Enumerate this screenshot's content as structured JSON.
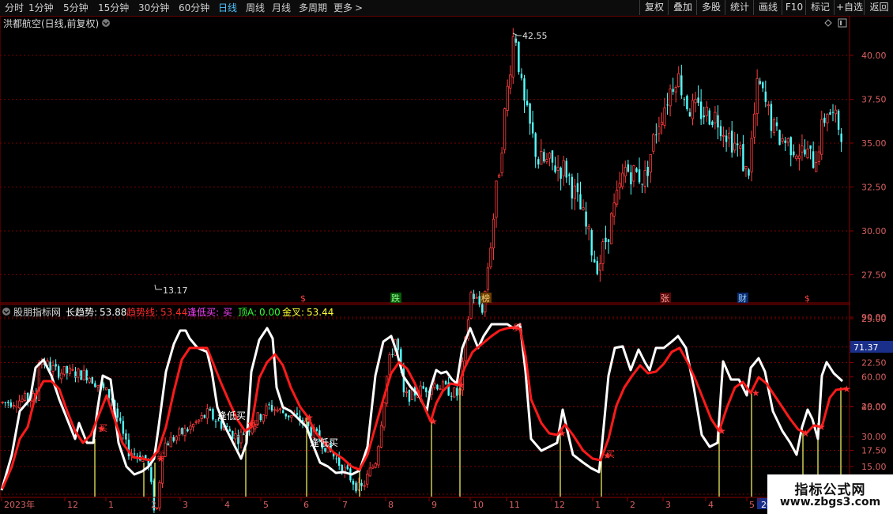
{
  "toolbar": {
    "periods": [
      "分时",
      "1分钟",
      "5分钟",
      "15分钟",
      "30分钟",
      "60分钟",
      "日线",
      "周线",
      "月线",
      "多周期",
      "更多"
    ],
    "active_period": "日线",
    "more_arrow": ">",
    "actions": [
      "复权",
      "叠加",
      "多股",
      "统计",
      "画线",
      "F10",
      "标记",
      "+自选",
      "返回"
    ]
  },
  "price_panel": {
    "title": "洪都航空(日线,前复权)",
    "high_label": "42.55",
    "low_label": "13.17",
    "axis_ticks": [
      "40.00",
      "37.50",
      "35.00",
      "32.50",
      "30.00",
      "27.50",
      "25.00",
      "22.50",
      "20.00",
      "17.50",
      "15.00"
    ],
    "events": [
      "$",
      "跌",
      "榜",
      "张",
      "财",
      "$"
    ],
    "colors": {
      "up": "#ff3c3c",
      "down": "#54ffff",
      "grid": "#8b0000"
    }
  },
  "indicator_panel": {
    "name": "股朋指标网",
    "values": [
      {
        "label": "长趋势:",
        "value": "53.88",
        "color": "#ffffff"
      },
      {
        "label": "趋势线:",
        "value": "53.44",
        "color": "#ff2a2a"
      },
      {
        "label": "逢低买:",
        "value": "买",
        "color": "#ff40ff"
      },
      {
        "label": "顶A:",
        "value": "0.00",
        "color": "#33ff33"
      },
      {
        "label": "金叉:",
        "value": "53.44",
        "color": "#ffff33"
      }
    ],
    "axis_ticks": [
      "90.00",
      "75.00",
      "60.00",
      "45.00",
      "30.00",
      "15.00"
    ],
    "current_value": "71.37",
    "signal_label": "买",
    "dip_label": "逢低买",
    "colors": {
      "long_trend": "#ffffff",
      "trend": "#ff1a1a",
      "bars": "#ffff66"
    }
  },
  "time_axis": {
    "labels": [
      "2023年",
      "12",
      "1",
      "2",
      "3",
      "4",
      "5",
      "6",
      "7",
      "8",
      "9",
      "10",
      "11",
      "12",
      "1",
      "2",
      "3",
      "4",
      "5",
      "20"
    ]
  },
  "watermark": {
    "line1": "指标公式网",
    "line2": "www.zbgs3.com"
  }
}
